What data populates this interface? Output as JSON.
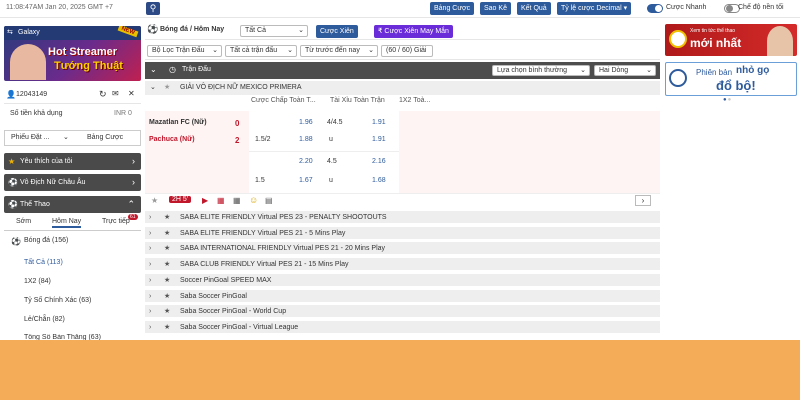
{
  "topbar": {
    "time": "11:08:47AM Jan 20, 2025 GMT +7",
    "buttons": [
      "Bảng Cược",
      "Sao Kê",
      "Kết Quả",
      "Tỷ lệ cược Decimal"
    ],
    "quick_bet": "Cược Nhanh",
    "dark_mode": "Chế độ nền tối"
  },
  "left": {
    "banner_head": "Galaxy",
    "banner_badge": "NEW",
    "banner_title": "Hot Streamer",
    "banner_subtitle": "Tướng Thuật",
    "account_id": "12043149",
    "balance_label": "Số tiền khả dụng",
    "balance_value": "INR 0",
    "tab1": "Phiếu Đặt ...",
    "tab2": "Bảng Cược",
    "favorites": "Yêu thích của tôi",
    "euro": "Vô Địch Nữ Châu Âu",
    "sports": "Thể Thao",
    "subtabs": [
      "Sớm",
      "Hôm Nay",
      "Trực tiếp"
    ],
    "live_count": "61",
    "sport_item": "Bóng đá (156)",
    "menu": [
      "Tất Cả (113)",
      "1X2 (84)",
      "Tỷ Số Chính Xác (63)",
      "Lẻ/Chẵn (82)",
      "Tổng Số Bàn Thắng (63)"
    ]
  },
  "main": {
    "title": "Bóng đá / Hôm Nay",
    "select_all": "Tất Cả",
    "btn_cuoc_xien": "Cược Xiên",
    "btn_may_man": "Cược Xiên May Mắn",
    "filter1": "Bộ Lọc Trận Đấu",
    "filter2": "Tất cả trận đấu",
    "filter3": "Từ trước đến nay",
    "filter_count": "(60 / 60) Giải",
    "section_label": "Trận Đấu",
    "sort_label": "Lựa chọn bình thường",
    "lines_label": "Hai Dòng",
    "league": "GIẢI VÔ ĐỊCH NỮ MEXICO PRIMERA",
    "odd_headers": [
      "Cược Chấp Toàn T...",
      "Tài Xỉu Toàn Trận",
      "1X2 Toà..."
    ],
    "team_home": "Mazatlan FC (Nữ)",
    "team_away": "Pachuca (Nữ)",
    "score_home": "0",
    "score_away": "2",
    "row1": {
      "hdp": "",
      "h1": "1.96",
      "ou": "4/4.5",
      "o1": "1.91"
    },
    "row2": {
      "hdp": "1.5/2",
      "h1": "1.88",
      "ou": "u",
      "o1": "1.91"
    },
    "row3": {
      "hdp": "",
      "h1": "2.20",
      "ou": "4.5",
      "o1": "2.16"
    },
    "row4": {
      "hdp": "1.5",
      "h1": "1.67",
      "ou": "u",
      "o1": "1.68"
    },
    "live_time": "2H 5'",
    "leagues": [
      "SABA ELITE FRIENDLY Virtual PES 23 - PENALTY SHOOTOUTS",
      "SABA ELITE FRIENDLY Virtual PES 21 - 5 Mins Play",
      "SABA INTERNATIONAL FRIENDLY Virtual PES 21 - 20 Mins Play",
      "SABA CLUB FRIENDLY Virtual PES 21 - 15 Mins Play",
      "Soccer PinGoal SPEED MAX",
      "Saba Soccer PinGoal",
      "Saba Soccer PinGoal - World Cup",
      "Saba Soccer PinGoal - Virtual League"
    ]
  },
  "right": {
    "ad1_small": "Xem tin tức thể thao",
    "ad1_big": "mới nhất",
    "ad2_small": "Phiên bản",
    "ad2_mid": "nhỏ gọ",
    "ad2_big": "đổ bộ!"
  },
  "colors": {
    "accent": "#2e5b9c",
    "purple": "#6a2bd8",
    "red": "#c0172b",
    "orange": "#f4ac58"
  }
}
